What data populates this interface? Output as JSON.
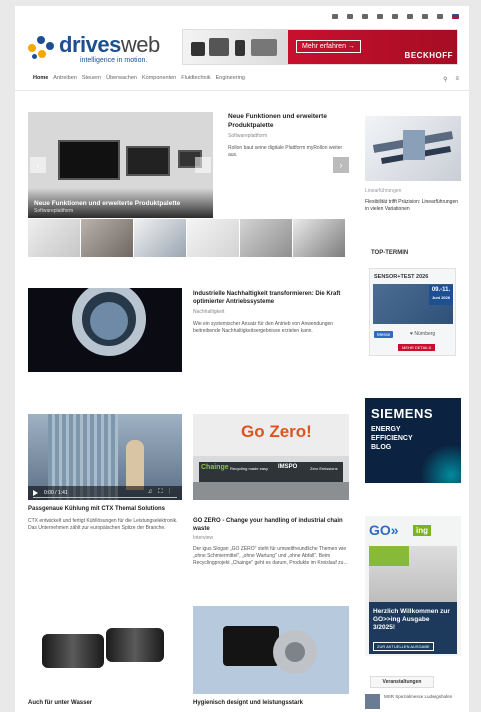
{
  "header": {
    "logo_brand": "drives",
    "logo_brand2": "web",
    "logo_tagline": "intelligence in motion.",
    "banner_cta": "Mehr erfahren →",
    "banner_brand": "BECKHOFF"
  },
  "nav": {
    "items": [
      "Home",
      "Antreiben",
      "Steuern",
      "Überwachen",
      "Komponenten",
      "Fluidtechnik",
      "Engineering"
    ],
    "search_icon": "search-icon",
    "menu_icon": "menu-icon"
  },
  "featured": {
    "slide_title": "Neue Funktionen und erweiterte Produktpalette",
    "slide_category": "Softwareplattform",
    "title": "Neue Funktionen und erweiterte Produktpalette",
    "category": "Softwareplattform",
    "excerpt": "Rollon baut seine digitale Plattform myRollon weiter aus."
  },
  "article2": {
    "title": "Industrielle Nachhaltigkeit transformieren: Die Kraft optimierter Antriebssysteme",
    "category": "Nachhaltigkeit",
    "excerpt": "Wie ein systemischer Ansatz für den Antrieb von Anwendungen beitreibende Nachhaltigkeitsergebnisse erzielen kann."
  },
  "card_video": {
    "time": "0:00 / 1:41",
    "title": "Passgenaue Kühlung mit CTX Themal Solutions",
    "excerpt": "CTX entwickelt und fertigt Kühllösungen für die Leistungselektronik. Das Unternehmen zählt zur europäischen Spitze der Branche."
  },
  "card_gozero": {
    "title": "GO ZERO - Change your handling of industrial chain waste",
    "category": "Interview",
    "excerpt": "Der igus Slogan „GO ZERO\" steht für umweltfreundliche Themen wie „ohne Schmiermittel\", „ohne Wartung\" und „ohne Abfall\". Beim Recyclingprojekt „Chainge\" geht es darum, Produkte im Kreislauf zu...",
    "image_headline": "Go Zero!",
    "image_sub1": "Chainge",
    "image_sub2": "Recycling made easy",
    "image_sub3": "IMSPO",
    "image_sub4": "Zero Emissions"
  },
  "card_wasser": {
    "title": "Auch für unter Wasser"
  },
  "card_hygiene": {
    "title": "Hygienisch designt und leistungsstark"
  },
  "sidebar": {
    "small_cat": "Linearführungen",
    "small_title": "Flexibilität trifft Präzision: Linearführungen in vielen Variationen",
    "top_termin": "TOP-TERMIN",
    "event_logo": "SENSOR+TEST 2026",
    "event_days": "09.-11.",
    "event_month": "Juni 2026",
    "event_badge": "Messe",
    "event_location": "♥ Nürnberg",
    "event_button": "MEHR DETAILS",
    "siemens_name": "SIEMENS",
    "siemens_blog": "ENERGY EFFICIENCY BLOG",
    "going_logo": "GO»",
    "going_ing": "ing",
    "going_welcome": "Herzlich Willkommen zur GO>>ing Ausgabe 3/2025!",
    "going_button": "ZUR AKTUELLEN AUSGABE",
    "events_tab": "Veranstaltungen",
    "event_item": "MSR Spezialmesse Ludwigshafen"
  }
}
